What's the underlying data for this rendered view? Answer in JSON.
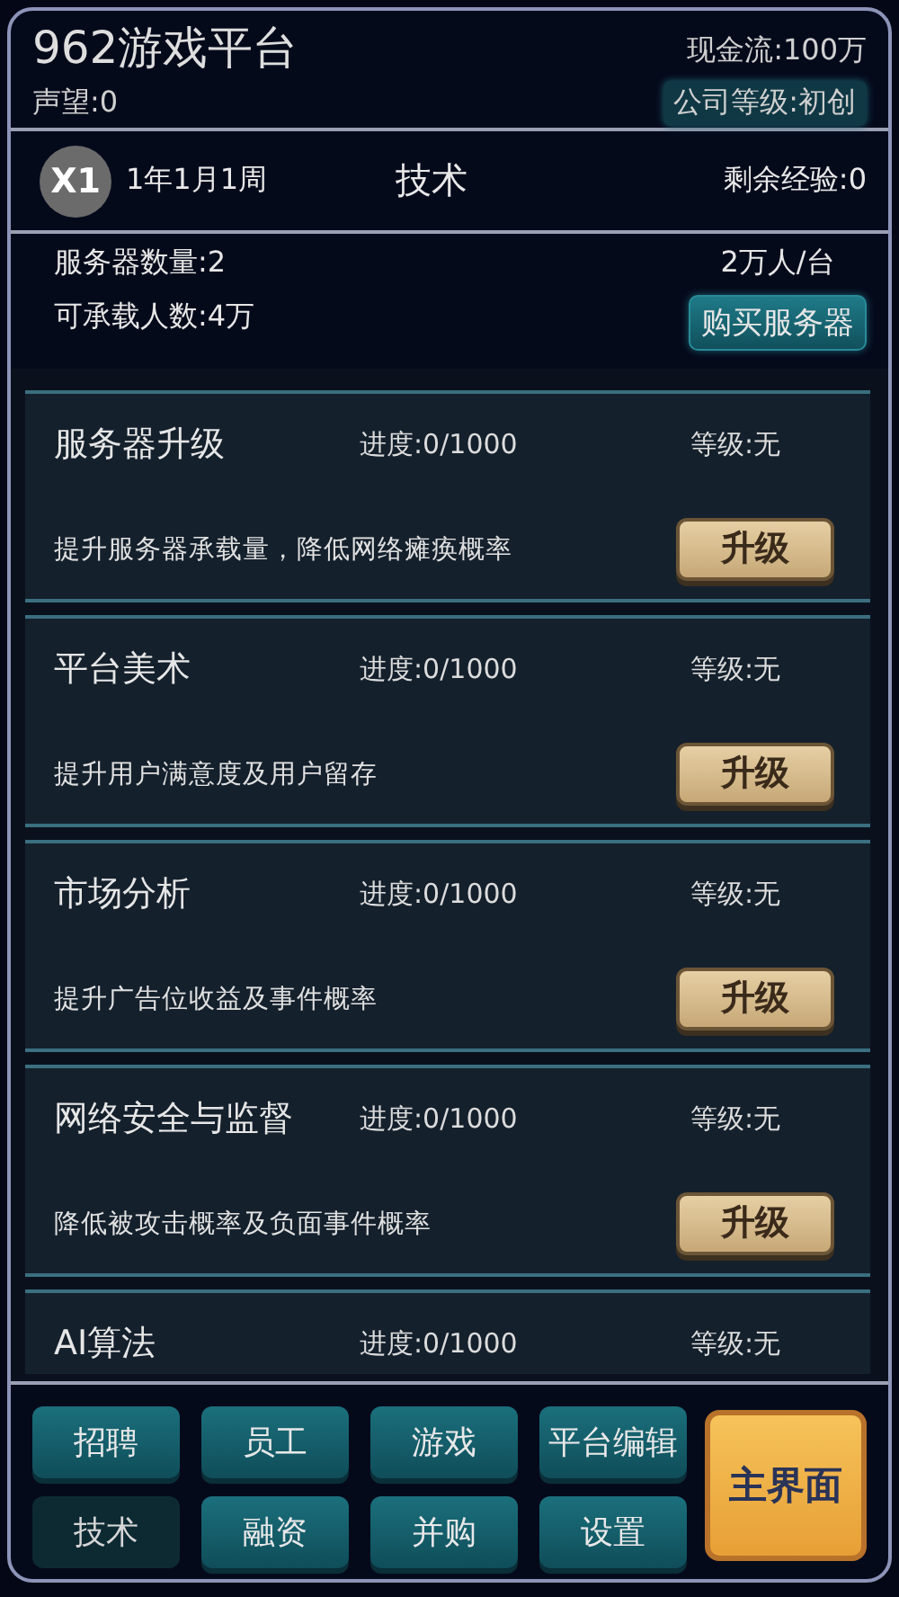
{
  "header": {
    "title": "962游戏平台",
    "reputation": "声望:0",
    "cash": "现金流:100万",
    "company_level": "公司等级:初创"
  },
  "status": {
    "speed": "X1",
    "date": "1年1月1周",
    "section": "技术",
    "remaining_exp": "剩余经验:0"
  },
  "servers": {
    "count": "服务器数量:2",
    "capacity": "可承载人数:4万",
    "per_server": "2万人/台",
    "buy_button": "购买服务器"
  },
  "techs": [
    {
      "name": "服务器升级",
      "progress": "进度:0/1000",
      "level": "等级:无",
      "description": "提升服务器承载量，降低网络瘫痪概率",
      "button": "升级"
    },
    {
      "name": "平台美术",
      "progress": "进度:0/1000",
      "level": "等级:无",
      "description": "提升用户满意度及用户留存",
      "button": "升级"
    },
    {
      "name": "市场分析",
      "progress": "进度:0/1000",
      "level": "等级:无",
      "description": "提升广告位收益及事件概率",
      "button": "升级"
    },
    {
      "name": "网络安全与监督",
      "progress": "进度:0/1000",
      "level": "等级:无",
      "description": "降低被攻击概率及负面事件概率",
      "button": "升级"
    },
    {
      "name": "AI算法",
      "progress": "进度:0/1000",
      "level": "等级:无"
    }
  ],
  "nav": [
    {
      "label": "招聘",
      "selected": false
    },
    {
      "label": "员工",
      "selected": false
    },
    {
      "label": "游戏",
      "selected": false
    },
    {
      "label": "平台编辑",
      "selected": false
    },
    {
      "label": "技术",
      "selected": true
    },
    {
      "label": "融资",
      "selected": false
    },
    {
      "label": "并购",
      "selected": false
    },
    {
      "label": "设置",
      "selected": false
    }
  ],
  "home_button": "主界面"
}
